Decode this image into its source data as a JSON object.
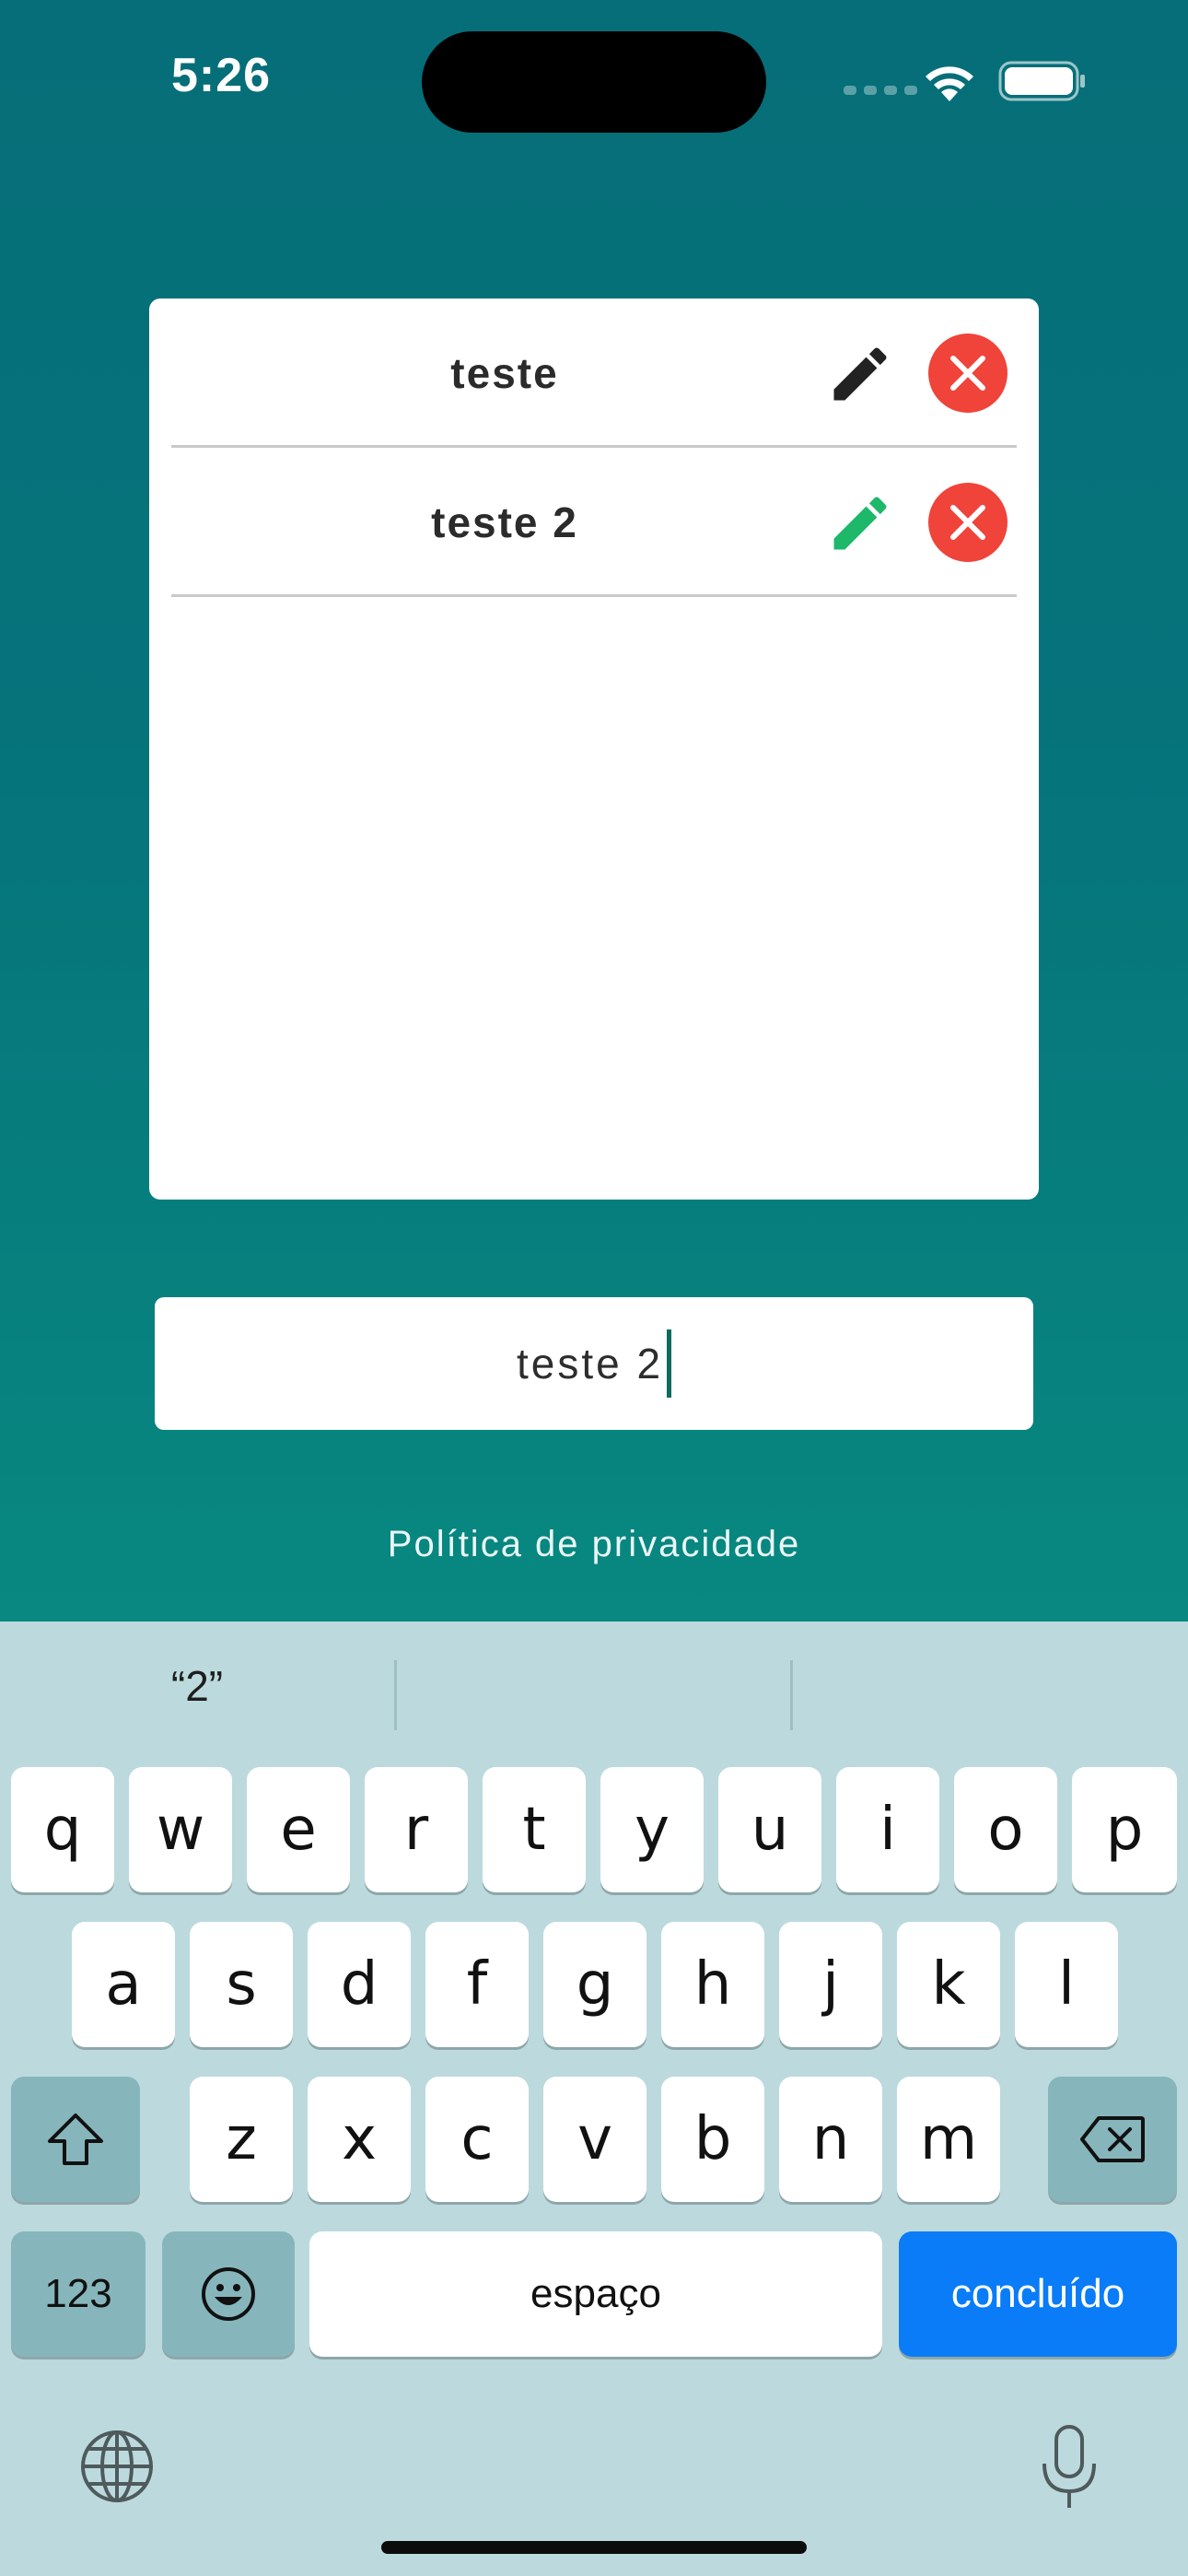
{
  "status_bar": {
    "time": "5:26"
  },
  "list": {
    "items": [
      {
        "label": "teste",
        "edit_icon_color": "#222222"
      },
      {
        "label": "teste 2",
        "edit_icon_color": "#1eb86a"
      }
    ]
  },
  "input": {
    "value": "teste 2"
  },
  "footer": {
    "privacy_link": "Política de privacidade"
  },
  "keyboard": {
    "suggestions": [
      "“2”",
      "",
      ""
    ],
    "row1": [
      "q",
      "w",
      "e",
      "r",
      "t",
      "y",
      "u",
      "i",
      "o",
      "p"
    ],
    "row2": [
      "a",
      "s",
      "d",
      "f",
      "g",
      "h",
      "j",
      "k",
      "l"
    ],
    "row3": [
      "z",
      "x",
      "c",
      "v",
      "b",
      "n",
      "m"
    ],
    "numbers_key": "123",
    "space_key": "espaço",
    "done_key": "concluído"
  },
  "colors": {
    "background_top": "#066e78",
    "background_bottom": "#088880",
    "delete_button": "#f0433a",
    "done_key": "#0a7cf7",
    "keyboard_background": "#bcdadd"
  }
}
